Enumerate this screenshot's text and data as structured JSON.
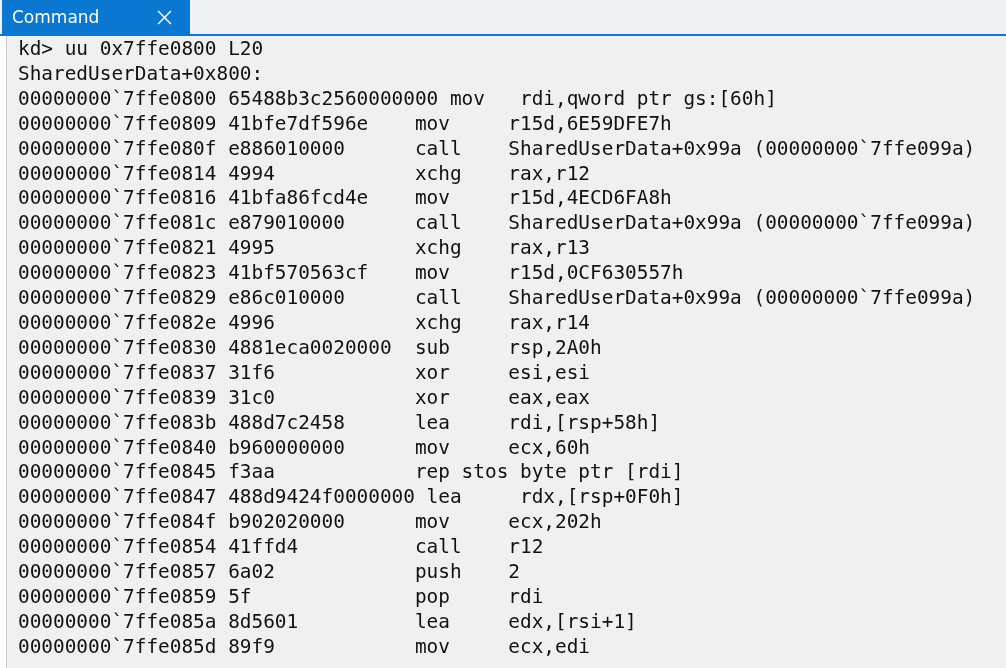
{
  "tabs": [
    {
      "label": "Command",
      "selected": true
    }
  ],
  "lines": [
    "kd> uu 0x7ffe0800 L20",
    "SharedUserData+0x800:",
    "00000000`7ffe0800 65488b3c2560000000 mov   rdi,qword ptr gs:[60h]",
    "00000000`7ffe0809 41bfe7df596e    mov     r15d,6E59DFE7h",
    "00000000`7ffe080f e886010000      call    SharedUserData+0x99a (00000000`7ffe099a)",
    "00000000`7ffe0814 4994            xchg    rax,r12",
    "00000000`7ffe0816 41bfa86fcd4e    mov     r15d,4ECD6FA8h",
    "00000000`7ffe081c e879010000      call    SharedUserData+0x99a (00000000`7ffe099a)",
    "00000000`7ffe0821 4995            xchg    rax,r13",
    "00000000`7ffe0823 41bf570563cf    mov     r15d,0CF630557h",
    "00000000`7ffe0829 e86c010000      call    SharedUserData+0x99a (00000000`7ffe099a)",
    "00000000`7ffe082e 4996            xchg    rax,r14",
    "00000000`7ffe0830 4881eca0020000  sub     rsp,2A0h",
    "00000000`7ffe0837 31f6            xor     esi,esi",
    "00000000`7ffe0839 31c0            xor     eax,eax",
    "00000000`7ffe083b 488d7c2458      lea     rdi,[rsp+58h]",
    "00000000`7ffe0840 b960000000      mov     ecx,60h",
    "00000000`7ffe0845 f3aa            rep stos byte ptr [rdi]",
    "00000000`7ffe0847 488d9424f0000000 lea     rdx,[rsp+0F0h]",
    "00000000`7ffe084f b902020000      mov     ecx,202h",
    "00000000`7ffe0854 41ffd4          call    r12",
    "00000000`7ffe0857 6a02            push    2",
    "00000000`7ffe0859 5f              pop     rdi",
    "00000000`7ffe085a 8d5601          lea     edx,[rsi+1]",
    "00000000`7ffe085d 89f9            mov     ecx,edi"
  ]
}
